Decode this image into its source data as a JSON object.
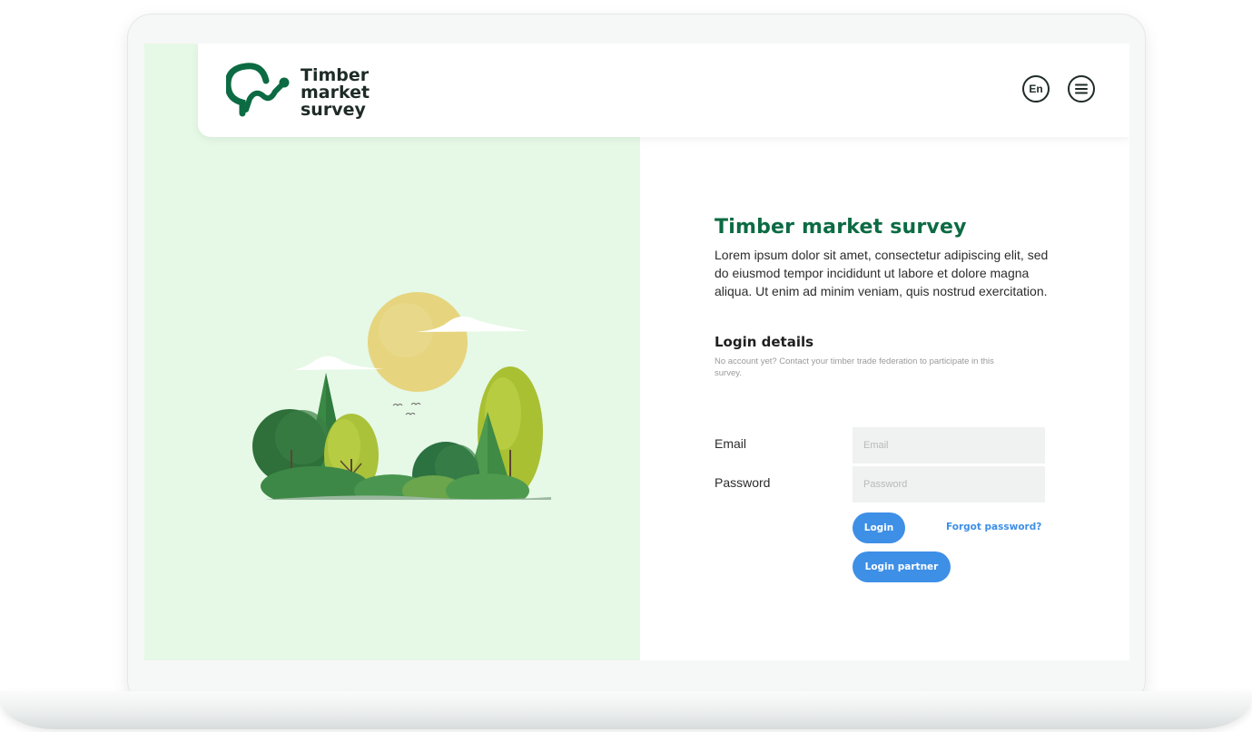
{
  "brand": {
    "logo_line1": "Timber",
    "logo_line2": "market",
    "logo_line3": "survey",
    "primary_color": "#0c6b43",
    "accent_color": "#3e8fe6",
    "panel_color": "#e6f8e6"
  },
  "header": {
    "language_label": "En",
    "language_icon": "language-circle-icon",
    "menu_icon": "hamburger-menu-icon"
  },
  "illustration": {
    "icon": "forest-illustration"
  },
  "main": {
    "title": "Timber market survey",
    "intro": "Lorem ipsum dolor sit amet, consectetur adipiscing elit, sed do eiusmod tempor incididunt ut labore et dolore magna aliqua. Ut enim ad minim veniam, quis nostrud exercitation."
  },
  "login": {
    "heading": "Login details",
    "note": "No account yet? Contact your timber trade federation to participate in this survey.",
    "email_label": "Email",
    "email_placeholder": "Email",
    "email_value": "",
    "password_label": "Password",
    "password_placeholder": "Password",
    "password_value": "",
    "login_button": "Login",
    "forgot_link": "Forgot password?",
    "partner_button": "Login partner"
  }
}
